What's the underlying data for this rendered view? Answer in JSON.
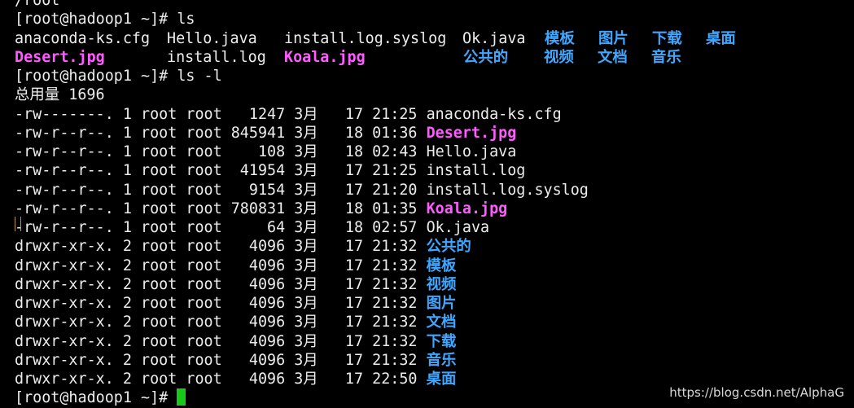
{
  "top_fragment": "/root",
  "prompt": "[root@hadoop1 ~]# ",
  "commands": {
    "ls": "ls",
    "ls_l": "ls -l"
  },
  "ls_output": {
    "row1": [
      {
        "text": "anaconda-ks.cfg",
        "kind": "file"
      },
      {
        "text": "Hello.java",
        "kind": "file"
      },
      {
        "text": "install.log.syslog",
        "kind": "file"
      },
      {
        "text": "Ok.java",
        "kind": "file"
      },
      {
        "text": "模板",
        "kind": "dir"
      },
      {
        "text": "图片",
        "kind": "dir"
      },
      {
        "text": "下载",
        "kind": "dir"
      },
      {
        "text": "桌面",
        "kind": "dir"
      }
    ],
    "row2": [
      {
        "text": "Desert.jpg",
        "kind": "image"
      },
      {
        "text": "install.log",
        "kind": "file"
      },
      {
        "text": "Koala.jpg",
        "kind": "image"
      },
      {
        "text": "公共的",
        "kind": "dir"
      },
      {
        "text": "视频",
        "kind": "dir"
      },
      {
        "text": "文档",
        "kind": "dir"
      },
      {
        "text": "音乐",
        "kind": "dir"
      }
    ]
  },
  "total_line": "总用量 1696",
  "listing": [
    {
      "meta": "-rw-------. 1 root root   1247 3月   17 21:25 ",
      "name": "anaconda-ks.cfg",
      "kind": "file"
    },
    {
      "meta": "-rw-r--r--. 1 root root 845941 3月   18 01:36 ",
      "name": "Desert.jpg",
      "kind": "image"
    },
    {
      "meta": "-rw-r--r--. 1 root root    108 3月   18 02:43 ",
      "name": "Hello.java",
      "kind": "file"
    },
    {
      "meta": "-rw-r--r--. 1 root root  41954 3月   17 21:25 ",
      "name": "install.log",
      "kind": "file"
    },
    {
      "meta": "-rw-r--r--. 1 root root   9154 3月   17 21:20 ",
      "name": "install.log.syslog",
      "kind": "file"
    },
    {
      "meta": "-rw-r--r--. 1 root root 780831 3月   18 01:35 ",
      "name": "Koala.jpg",
      "kind": "image"
    },
    {
      "meta": "-rw-r--r--. 1 root root     64 3月   18 02:57 ",
      "name": "Ok.java",
      "kind": "file"
    },
    {
      "meta": "drwxr-xr-x. 2 root root   4096 3月   17 21:32 ",
      "name": "公共的",
      "kind": "dir"
    },
    {
      "meta": "drwxr-xr-x. 2 root root   4096 3月   17 21:32 ",
      "name": "模板",
      "kind": "dir"
    },
    {
      "meta": "drwxr-xr-x. 2 root root   4096 3月   17 21:32 ",
      "name": "视频",
      "kind": "dir"
    },
    {
      "meta": "drwxr-xr-x. 2 root root   4096 3月   17 21:32 ",
      "name": "图片",
      "kind": "dir"
    },
    {
      "meta": "drwxr-xr-x. 2 root root   4096 3月   17 21:32 ",
      "name": "文档",
      "kind": "dir"
    },
    {
      "meta": "drwxr-xr-x. 2 root root   4096 3月   17 21:32 ",
      "name": "下载",
      "kind": "dir"
    },
    {
      "meta": "drwxr-xr-x. 2 root root   4096 3月   17 21:32 ",
      "name": "音乐",
      "kind": "dir"
    },
    {
      "meta": "drwxr-xr-x. 2 root root   4096 3月   17 22:50 ",
      "name": "桌面",
      "kind": "dir"
    }
  ],
  "watermark": "https://blog.csdn.net/AlphaG",
  "colors": {
    "background": "#000000",
    "text": "#ececec",
    "directory": "#3fa7ff",
    "image": "#ff5cff",
    "cursor": "#19c919"
  }
}
